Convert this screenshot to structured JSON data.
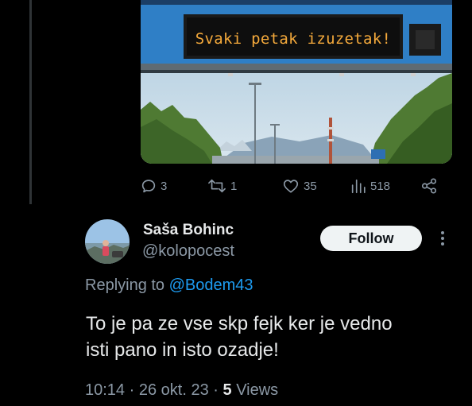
{
  "media": {
    "sign_text": "Svaki petak izuzetak!"
  },
  "actions": {
    "replies": "3",
    "reposts": "1",
    "likes": "35",
    "views": "518"
  },
  "reply_tweet": {
    "display_name": "Saša Bohinc",
    "handle": "@kolopocest",
    "follow_label": "Follow",
    "replying_prefix": "Replying to",
    "replying_to": "@Bodem43",
    "text_line1": "To je pa ze vse skp fejk ker je vedno",
    "text_line2": "isti pano in isto ozadje!",
    "time": "10:14",
    "date": "26 okt. 23",
    "views_count": "5",
    "views_label": "Views",
    "separator": "·"
  },
  "colors": {
    "background": "#000000",
    "text_primary": "#e7e9ea",
    "text_secondary": "#8b98a5",
    "link": "#1d9bf0",
    "sign_led": "#f4a93b"
  },
  "icons": [
    "reply-icon",
    "repost-icon",
    "like-icon",
    "views-icon",
    "share-icon",
    "more-icon"
  ]
}
